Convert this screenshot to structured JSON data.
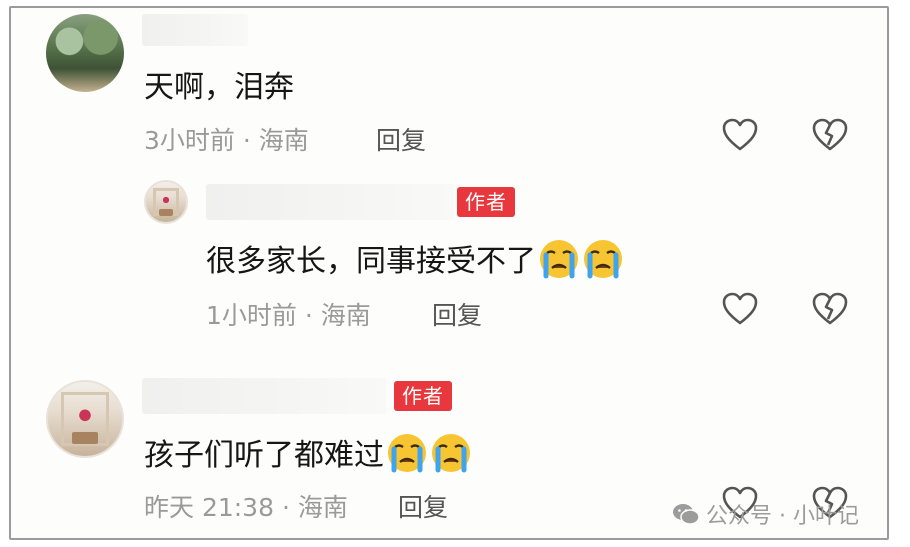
{
  "comments": [
    {
      "avatar": "forest-path-avatar",
      "text": "天啊，泪奔",
      "time": "3小时前",
      "location": "海南",
      "reply_label": "回复",
      "is_author": false
    },
    {
      "avatar": "photo-frame-avatar",
      "author_badge": "作者",
      "text": "很多家长，同事接受不了",
      "emoji": [
        "crying-face-emoji",
        "crying-face-emoji"
      ],
      "time": "1小时前",
      "location": "海南",
      "reply_label": "回复",
      "is_author": true
    },
    {
      "avatar": "photo-frame-avatar",
      "author_badge": "作者",
      "text": "孩子们听了都难过",
      "emoji": [
        "crying-face-emoji",
        "crying-face-emoji"
      ],
      "time": "昨天 21:38",
      "location": "海南",
      "reply_label": "回复",
      "is_author": true
    }
  ],
  "separator": "·",
  "icons": {
    "like": "heart-outline-icon",
    "dislike": "broken-heart-icon"
  },
  "watermark": {
    "text": "公众号 · 小叶记",
    "icon": "wechat-icon"
  },
  "colors": {
    "badge": "#e8383d",
    "meta": "#9a9a9a",
    "text": "#161616"
  }
}
